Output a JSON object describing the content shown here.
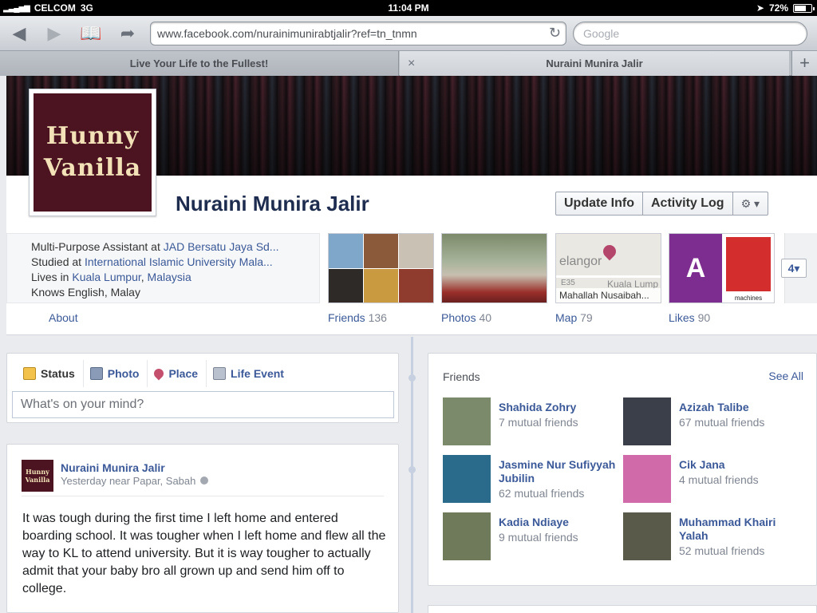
{
  "statusbar": {
    "carrier": "CELCOM",
    "network": "3G",
    "time": "11:04 PM",
    "battery": "72%",
    "battery_level": 0.72
  },
  "browser": {
    "url": "www.facebook.com/nurainimunirabtjalir?ref=tn_tnmn",
    "search_placeholder": "Google",
    "tabs": [
      {
        "title": "Live Your Life to the Fullest!"
      },
      {
        "title": "Nuraini Munira Jalir"
      }
    ]
  },
  "profile": {
    "name": "Nuraini Munira Jalir",
    "picture_text_line1": "Hunny",
    "picture_text_line2": "Vanilla",
    "buttons": {
      "update_info": "Update Info",
      "activity_log": "Activity Log"
    },
    "about": {
      "work_prefix": "Multi-Purpose Assistant at ",
      "work_link": "JAD Bersatu Jaya Sd...",
      "study_prefix": "Studied at ",
      "study_link": "International Islamic University Mala...",
      "lives_prefix": "Lives in ",
      "lives_city": "Kuala Lumpur",
      "lives_sep": ", ",
      "lives_country": "Malaysia",
      "languages": "Knows English, Malay",
      "about_link": "About"
    },
    "sections": {
      "friends": {
        "label": "Friends",
        "count": "136"
      },
      "photos": {
        "label": "Photos",
        "count": "40"
      },
      "map": {
        "label": "Map",
        "count": "79",
        "map_place": "elangor",
        "map_city": "Kuala Lump",
        "map_road": "E35",
        "caption": "Mahallah Nusaibah..."
      },
      "likes": {
        "label": "Likes",
        "count": "90",
        "likes_caption": "machines"
      }
    },
    "more_count": "4"
  },
  "composer": {
    "tabs": [
      {
        "label": "Status"
      },
      {
        "label": "Photo"
      },
      {
        "label": "Place"
      },
      {
        "label": "Life Event"
      }
    ],
    "placeholder": "What's on your mind?"
  },
  "post": {
    "avatar_line1": "Hunny",
    "avatar_line2": "Vanilla",
    "author": "Nuraini Munira Jalir",
    "meta": "Yesterday near Papar, Sabah",
    "text": "It was tough during the first time I left home and entered boarding school. It was tougher when I left home and flew all the way to KL to attend university. But it is way tougher to actually admit that your baby bro all grown up and send him off to college."
  },
  "friends_box": {
    "title": "Friends",
    "see_all": "See All",
    "friends": [
      {
        "name": "Shahida Zohry",
        "mutual": "7 mutual friends",
        "color": "#7a8a6a"
      },
      {
        "name": "Azizah Talibe",
        "mutual": "67 mutual friends",
        "color": "#3a3f4a"
      },
      {
        "name": "Jasmine Nur Sufiyyah Jubilin",
        "mutual": "62 mutual friends",
        "color": "#2a6a8a"
      },
      {
        "name": "Cik Jana",
        "mutual": "4 mutual friends",
        "color": "#d06aa8"
      },
      {
        "name": "Kadia Ndiaye",
        "mutual": "9 mutual friends",
        "color": "#6f7a5a"
      },
      {
        "name": "Muhammad Khairi Yalah",
        "mutual": "52 mutual friends",
        "color": "#5a5a4a"
      }
    ]
  }
}
